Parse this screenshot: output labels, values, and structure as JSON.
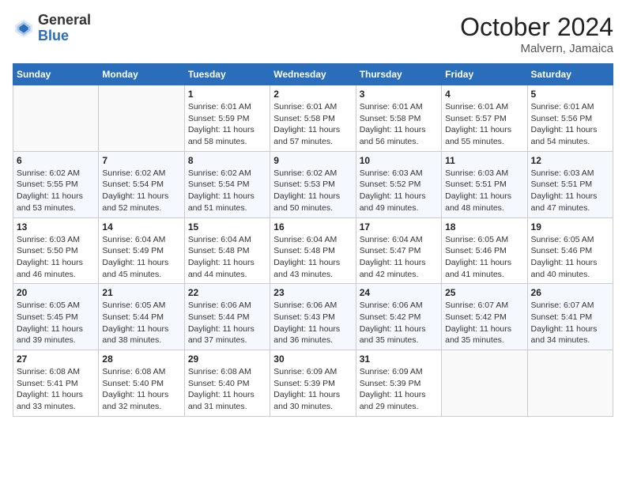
{
  "header": {
    "logo_line1": "General",
    "logo_line2": "Blue",
    "month": "October 2024",
    "location": "Malvern, Jamaica"
  },
  "weekdays": [
    "Sunday",
    "Monday",
    "Tuesday",
    "Wednesday",
    "Thursday",
    "Friday",
    "Saturday"
  ],
  "weeks": [
    [
      {
        "day": "",
        "detail": ""
      },
      {
        "day": "",
        "detail": ""
      },
      {
        "day": "1",
        "detail": "Sunrise: 6:01 AM\nSunset: 5:59 PM\nDaylight: 11 hours and 58 minutes."
      },
      {
        "day": "2",
        "detail": "Sunrise: 6:01 AM\nSunset: 5:58 PM\nDaylight: 11 hours and 57 minutes."
      },
      {
        "day": "3",
        "detail": "Sunrise: 6:01 AM\nSunset: 5:58 PM\nDaylight: 11 hours and 56 minutes."
      },
      {
        "day": "4",
        "detail": "Sunrise: 6:01 AM\nSunset: 5:57 PM\nDaylight: 11 hours and 55 minutes."
      },
      {
        "day": "5",
        "detail": "Sunrise: 6:01 AM\nSunset: 5:56 PM\nDaylight: 11 hours and 54 minutes."
      }
    ],
    [
      {
        "day": "6",
        "detail": "Sunrise: 6:02 AM\nSunset: 5:55 PM\nDaylight: 11 hours and 53 minutes."
      },
      {
        "day": "7",
        "detail": "Sunrise: 6:02 AM\nSunset: 5:54 PM\nDaylight: 11 hours and 52 minutes."
      },
      {
        "day": "8",
        "detail": "Sunrise: 6:02 AM\nSunset: 5:54 PM\nDaylight: 11 hours and 51 minutes."
      },
      {
        "day": "9",
        "detail": "Sunrise: 6:02 AM\nSunset: 5:53 PM\nDaylight: 11 hours and 50 minutes."
      },
      {
        "day": "10",
        "detail": "Sunrise: 6:03 AM\nSunset: 5:52 PM\nDaylight: 11 hours and 49 minutes."
      },
      {
        "day": "11",
        "detail": "Sunrise: 6:03 AM\nSunset: 5:51 PM\nDaylight: 11 hours and 48 minutes."
      },
      {
        "day": "12",
        "detail": "Sunrise: 6:03 AM\nSunset: 5:51 PM\nDaylight: 11 hours and 47 minutes."
      }
    ],
    [
      {
        "day": "13",
        "detail": "Sunrise: 6:03 AM\nSunset: 5:50 PM\nDaylight: 11 hours and 46 minutes."
      },
      {
        "day": "14",
        "detail": "Sunrise: 6:04 AM\nSunset: 5:49 PM\nDaylight: 11 hours and 45 minutes."
      },
      {
        "day": "15",
        "detail": "Sunrise: 6:04 AM\nSunset: 5:48 PM\nDaylight: 11 hours and 44 minutes."
      },
      {
        "day": "16",
        "detail": "Sunrise: 6:04 AM\nSunset: 5:48 PM\nDaylight: 11 hours and 43 minutes."
      },
      {
        "day": "17",
        "detail": "Sunrise: 6:04 AM\nSunset: 5:47 PM\nDaylight: 11 hours and 42 minutes."
      },
      {
        "day": "18",
        "detail": "Sunrise: 6:05 AM\nSunset: 5:46 PM\nDaylight: 11 hours and 41 minutes."
      },
      {
        "day": "19",
        "detail": "Sunrise: 6:05 AM\nSunset: 5:46 PM\nDaylight: 11 hours and 40 minutes."
      }
    ],
    [
      {
        "day": "20",
        "detail": "Sunrise: 6:05 AM\nSunset: 5:45 PM\nDaylight: 11 hours and 39 minutes."
      },
      {
        "day": "21",
        "detail": "Sunrise: 6:05 AM\nSunset: 5:44 PM\nDaylight: 11 hours and 38 minutes."
      },
      {
        "day": "22",
        "detail": "Sunrise: 6:06 AM\nSunset: 5:44 PM\nDaylight: 11 hours and 37 minutes."
      },
      {
        "day": "23",
        "detail": "Sunrise: 6:06 AM\nSunset: 5:43 PM\nDaylight: 11 hours and 36 minutes."
      },
      {
        "day": "24",
        "detail": "Sunrise: 6:06 AM\nSunset: 5:42 PM\nDaylight: 11 hours and 35 minutes."
      },
      {
        "day": "25",
        "detail": "Sunrise: 6:07 AM\nSunset: 5:42 PM\nDaylight: 11 hours and 35 minutes."
      },
      {
        "day": "26",
        "detail": "Sunrise: 6:07 AM\nSunset: 5:41 PM\nDaylight: 11 hours and 34 minutes."
      }
    ],
    [
      {
        "day": "27",
        "detail": "Sunrise: 6:08 AM\nSunset: 5:41 PM\nDaylight: 11 hours and 33 minutes."
      },
      {
        "day": "28",
        "detail": "Sunrise: 6:08 AM\nSunset: 5:40 PM\nDaylight: 11 hours and 32 minutes."
      },
      {
        "day": "29",
        "detail": "Sunrise: 6:08 AM\nSunset: 5:40 PM\nDaylight: 11 hours and 31 minutes."
      },
      {
        "day": "30",
        "detail": "Sunrise: 6:09 AM\nSunset: 5:39 PM\nDaylight: 11 hours and 30 minutes."
      },
      {
        "day": "31",
        "detail": "Sunrise: 6:09 AM\nSunset: 5:39 PM\nDaylight: 11 hours and 29 minutes."
      },
      {
        "day": "",
        "detail": ""
      },
      {
        "day": "",
        "detail": ""
      }
    ]
  ]
}
